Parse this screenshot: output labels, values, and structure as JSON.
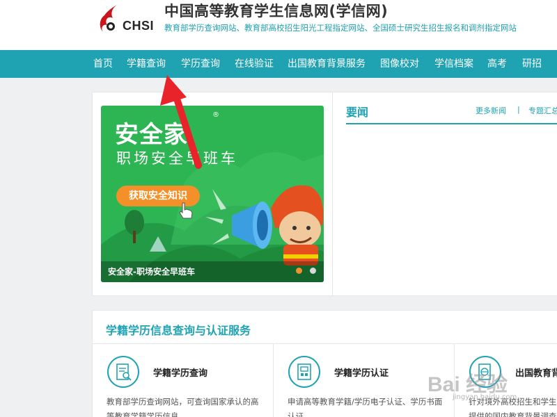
{
  "header": {
    "logo_text": "CHSI",
    "title": "中国高等教育学生信息网(学信网)",
    "subtitle": "教育部学历查询网站、教育部高校招生阳光工程指定网站、全国硕士研究生招生报名和调剂指定网站"
  },
  "nav": {
    "items": [
      {
        "label": "首页"
      },
      {
        "label": "学籍查询"
      },
      {
        "label": "学历查询"
      },
      {
        "label": "在线验证"
      },
      {
        "label": "出国教育背景服务"
      },
      {
        "label": "图像校对"
      },
      {
        "label": "学信档案"
      },
      {
        "label": "高考"
      },
      {
        "label": "研招"
      }
    ]
  },
  "banner": {
    "title": "安全家",
    "reg_mark": "®",
    "subtitle": "职场安全早班车",
    "button_label": "获取安全知识",
    "caption": "安全家-职场安全早班车"
  },
  "news": {
    "title": "要闻",
    "more_label": "更多新闻",
    "separator": "|",
    "topic_label": "专题汇总"
  },
  "services": {
    "heading": "学籍学历信息查询与认证服务",
    "items": [
      {
        "name": "学籍学历查询",
        "desc": "教育部学历查询网站，可查询国家承认的高等教育学籍学历信息"
      },
      {
        "name": "学籍学历认证",
        "desc": "申请高等教育学籍/学历电子认证、学历书面认证"
      },
      {
        "name": "出国教育背景",
        "desc": "针对境外高校招生和学生提供的国内教育背景调查"
      }
    ]
  },
  "watermark": {
    "text": "Bai 经验",
    "sub": "jingyan.baidu.com"
  },
  "colors": {
    "accent": "#1fa3b3",
    "banner_green": "#2db553",
    "button_orange": "#f4902a",
    "annotation_red": "#e8232a"
  }
}
